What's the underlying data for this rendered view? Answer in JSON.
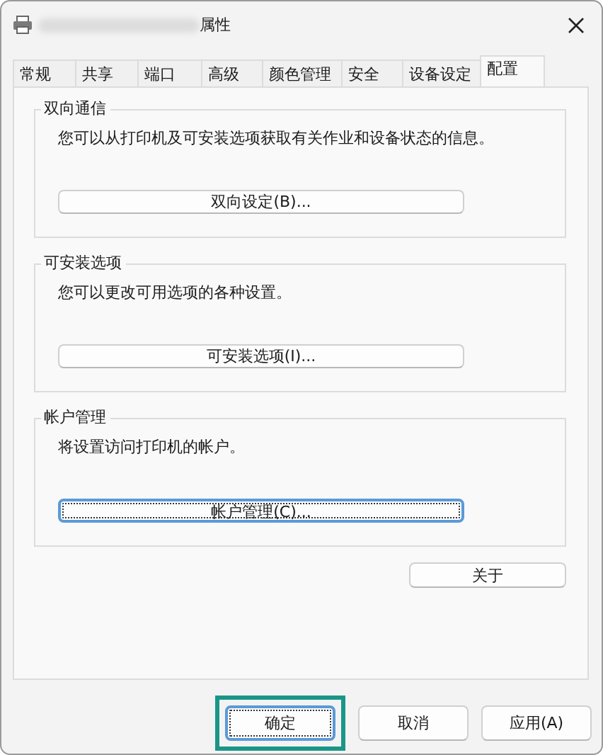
{
  "window": {
    "title": "属性"
  },
  "tabs": [
    {
      "label": "常规",
      "selected": false
    },
    {
      "label": "共享",
      "selected": false
    },
    {
      "label": "端口",
      "selected": false
    },
    {
      "label": "高级",
      "selected": false
    },
    {
      "label": "颜色管理",
      "selected": false
    },
    {
      "label": "安全",
      "selected": false
    },
    {
      "label": "设备设定",
      "selected": false
    },
    {
      "label": "配置",
      "selected": true
    }
  ],
  "groups": [
    {
      "title": "双向通信",
      "description": "您可以从打印机及可安装选项获取有关作业和设备状态的信息。",
      "button": {
        "label": "双向设定(B)...",
        "focused": false
      }
    },
    {
      "title": "可安装选项",
      "description": "您可以更改可用选项的各种设置。",
      "button": {
        "label": "可安装选项(I)...",
        "focused": false
      }
    },
    {
      "title": "帐户管理",
      "description": "将设置访问打印机的帐户。",
      "button": {
        "label": "帐户管理(C)...",
        "focused": true
      }
    }
  ],
  "about_button": {
    "label": "关于"
  },
  "footer_buttons": [
    {
      "label": "确定",
      "focused": true
    },
    {
      "label": "取消",
      "focused": false
    },
    {
      "label": "应用(A)",
      "focused": false
    }
  ]
}
